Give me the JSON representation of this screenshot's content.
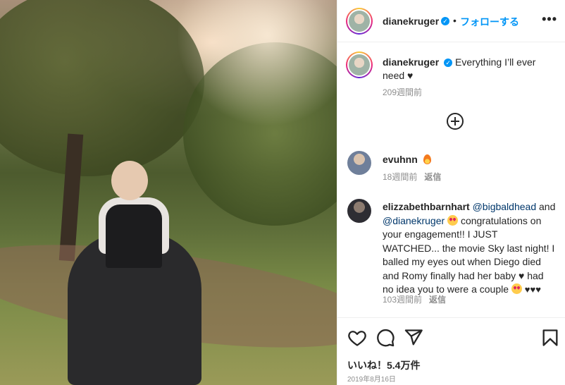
{
  "header": {
    "username": "dianekruger",
    "dot": "•",
    "follow_label": "フォローする",
    "more_label": "•••"
  },
  "caption": {
    "username": "dianekruger",
    "text": "Everything I’ll ever need ♥",
    "time": "209週間前"
  },
  "comments": [
    {
      "username": "evuhnn",
      "text": "",
      "time": "18週間前",
      "reply": "返信"
    },
    {
      "username": "elizzabethbarnhart",
      "mention1": "@bigbaldhead",
      "and": "and",
      "mention2": "@dianekruger",
      "text": "congratulations on your engagement!! I JUST WATCHED... the movie Sky last night! I balled my eyes out when Diego died and Romy finally had her baby ♥ had no idea you to were a couple",
      "hearts": "♥♥♥",
      "time": "103週間前",
      "reply": "返信"
    }
  ],
  "footer": {
    "likes": "いいね！5.4万件",
    "date": "2019年8月16日"
  },
  "icons": {
    "verified": "verified-badge-icon",
    "add": "add-comment-icon",
    "like": "heart-icon",
    "comment": "comment-bubble-icon",
    "share": "paper-plane-icon",
    "save": "bookmark-icon"
  },
  "colors": {
    "accent": "#0095f6",
    "text": "#262626",
    "muted": "#8e8e8e",
    "mention": "#00376b"
  }
}
